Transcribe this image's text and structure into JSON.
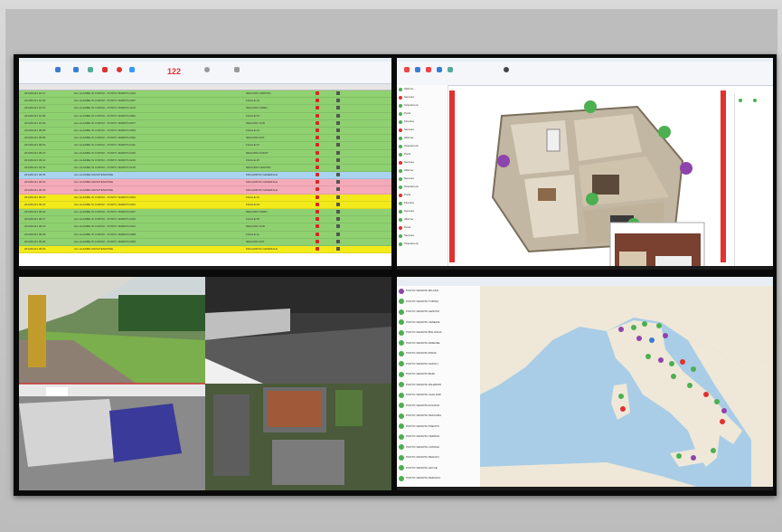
{
  "wall": {
    "screens": [
      {
        "name": "alarm-list",
        "counter": "122",
        "rows": [
          {
            "color": "green",
            "date": "2014/01/21 10:11",
            "msg": "ALL ALARME IN CORSO  - PUNTO VENDITA 2314",
            "place": "NEGOZIO CENTRO"
          },
          {
            "color": "green",
            "date": "2014/01/21 10:09",
            "msg": "ALL ALARME IN CORSO  - PUNTO VENDITA 2007",
            "place": "FILIALE 12"
          },
          {
            "color": "green",
            "date": "2014/01/21 10:07",
            "msg": "ALL ALARME IN CORSO  - PUNTO VENDITA 1123",
            "place": "NEGOZIO NORD"
          },
          {
            "color": "green",
            "date": "2014/01/21 10:05",
            "msg": "ALL ALARME IN CORSO  - PUNTO VENDITA 0981",
            "place": "FILIALE 03"
          },
          {
            "color": "green",
            "date": "2014/01/21 10:02",
            "msg": "ALL ALARME IN CORSO  - PUNTO VENDITA 0877",
            "place": "NEGOZIO SUD"
          },
          {
            "color": "green",
            "date": "2014/01/21 09:58",
            "msg": "ALL ALARME IN CORSO  - PUNTO VENDITA 0654",
            "place": "FILIALE 21"
          },
          {
            "color": "green",
            "date": "2014/01/21 09:55",
            "msg": "ALL ALARME IN CORSO  - PUNTO VENDITA 0532",
            "place": "NEGOZIO EST"
          },
          {
            "color": "green",
            "date": "2014/01/21 09:51",
            "msg": "ALL ALARME IN CORSO  - PUNTO VENDITA 0411",
            "place": "FILIALE 07"
          },
          {
            "color": "green",
            "date": "2014/01/21 09:47",
            "msg": "ALL ALARME IN CORSO  - PUNTO VENDITA 0322",
            "place": "NEGOZIO OVEST"
          },
          {
            "color": "green",
            "date": "2014/01/21 09:44",
            "msg": "ALL ALARME IN CORSO  - PUNTO VENDITA 0219",
            "place": "FILIALE 15"
          },
          {
            "color": "green",
            "date": "2014/01/21 09:40",
            "msg": "ALL ALARME IN CORSO  - PUNTO VENDITA 0118",
            "place": "NEGOZIO CENTRO"
          },
          {
            "color": "blue",
            "date": "2014/01/21 09:36",
            "msg": "ALL ALARME MANUTENZIONE",
            "place": "MAGAZZINO GENERALE"
          },
          {
            "color": "pink",
            "date": "2014/01/21 09:33",
            "msg": "ALL ALARME MANUTENZIONE",
            "place": "MAGAZZINO GENERALE"
          },
          {
            "color": "pink",
            "date": "2014/01/21 09:30",
            "msg": "ALL ALARME MANUTENZIONE",
            "place": "MAGAZZINO GENERALE"
          },
          {
            "color": "yellow",
            "date": "2014/01/21 09:27",
            "msg": "ALL ALARME IN CORSO  - PUNTO VENDITA 0044",
            "place": "FILIALE 02"
          },
          {
            "color": "yellow",
            "date": "2014/01/21 09:24",
            "msg": "ALL ALARME IN CORSO  - PUNTO VENDITA 0031",
            "place": "FILIALE 09"
          },
          {
            "color": "green",
            "date": "2014/01/21 09:20",
            "msg": "ALL ALARME IN CORSO  - PUNTO VENDITA 0027",
            "place": "NEGOZIO NORD"
          },
          {
            "color": "green",
            "date": "2014/01/21 09:17",
            "msg": "ALL ALARME IN CORSO  - PUNTO VENDITA 0019",
            "place": "FILIALE 05"
          },
          {
            "color": "green",
            "date": "2014/01/21 09:13",
            "msg": "ALL ALARME IN CORSO  - PUNTO VENDITA 0012",
            "place": "NEGOZIO SUD"
          },
          {
            "color": "green",
            "date": "2014/01/21 09:09",
            "msg": "ALL ALARME IN CORSO  - PUNTO VENDITA 0008",
            "place": "FILIALE 11"
          },
          {
            "color": "green",
            "date": "2014/01/21 09:06",
            "msg": "ALL ALARME IN CORSO  - PUNTO VENDITA 0005",
            "place": "NEGOZIO EST"
          },
          {
            "color": "yellow",
            "date": "2014/01/21 09:02",
            "msg": "ALL ALARME MANUTENZIONE",
            "place": "MAGAZZINO GENERALE"
          }
        ]
      },
      {
        "name": "floorplan-3d",
        "list_items": [
          "Allarme",
          "Sensore",
          "Telecamera",
          "Porta",
          "Finestra",
          "Sensore",
          "Allarme",
          "Telecamera",
          "Porta",
          "Sensore",
          "Allarme",
          "Sensore",
          "Telecamera",
          "Porta",
          "Finestra",
          "Sensore",
          "Allarme",
          "Porta",
          "Sensore",
          "Telecamera"
        ]
      },
      {
        "name": "camera-grid"
      },
      {
        "name": "italy-map",
        "list_items": [
          "PUNTO VENDITA MILANO",
          "PUNTO VENDITA TORINO",
          "PUNTO VENDITA GENOVA",
          "PUNTO VENDITA VENEZIA",
          "PUNTO VENDITA BOLOGNA",
          "PUNTO VENDITA FIRENZE",
          "PUNTO VENDITA ROMA",
          "PUNTO VENDITA NAPOLI",
          "PUNTO VENDITA BARI",
          "PUNTO VENDITA PALERMO",
          "PUNTO VENDITA CAGLIARI",
          "PUNTO VENDITA ANCONA",
          "PUNTO VENDITA PESCARA",
          "PUNTO VENDITA TRENTO",
          "PUNTO VENDITA VERONA",
          "PUNTO VENDITA CATANIA",
          "PUNTO VENDITA REGGIO",
          "PUNTO VENDITA LECCE",
          "PUNTO VENDITA PERUGIA"
        ]
      }
    ]
  },
  "colors": {
    "green": "#8fd070",
    "blue": "#a9d3f0",
    "pink": "#f4aab8",
    "yellow": "#f2ea1a",
    "accent": "#e0322f"
  }
}
